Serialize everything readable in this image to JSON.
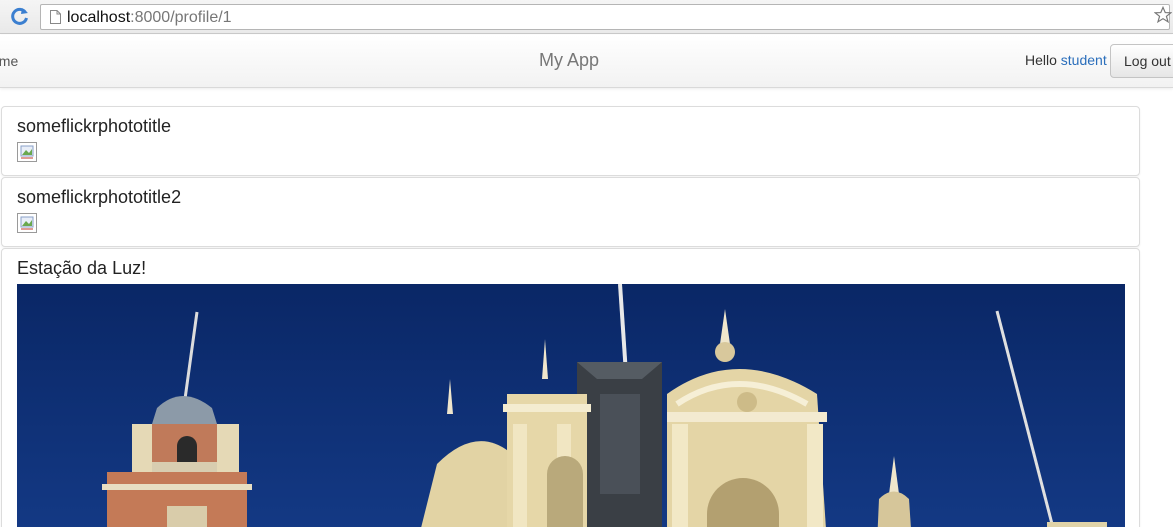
{
  "browser": {
    "url_host": "localhost",
    "url_rest": ":8000/profile/1"
  },
  "navbar": {
    "home_label": "ome",
    "brand": "My App",
    "greeting": "Hello",
    "username": "student",
    "logout_label": "Log out"
  },
  "photos": [
    {
      "title": "someflickrphototitle"
    },
    {
      "title": "someflickrphototitle2"
    },
    {
      "title": "Estação da Luz!"
    }
  ],
  "colors": {
    "link": "#2a6ebb",
    "sky": "#0d2a6e"
  }
}
